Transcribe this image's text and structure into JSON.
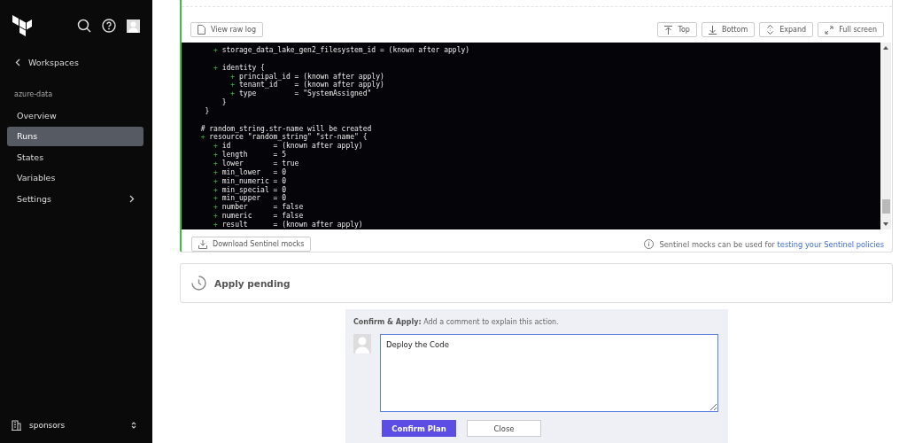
{
  "sidebar": {
    "back_link": "Workspaces",
    "workspace": "azure-data",
    "items": [
      {
        "label": "Overview",
        "selected": false,
        "expandable": false
      },
      {
        "label": "Runs",
        "selected": true,
        "expandable": false
      },
      {
        "label": "States",
        "selected": false,
        "expandable": false
      },
      {
        "label": "Variables",
        "selected": false,
        "expandable": false
      },
      {
        "label": "Settings",
        "selected": false,
        "expandable": true
      }
    ],
    "organization": "sponsors"
  },
  "log_panel": {
    "toolbar_left": [
      "View raw log"
    ],
    "toolbar_right": [
      "Top",
      "Bottom",
      "Expand",
      "Full screen"
    ],
    "lines": [
      {
        "kind": "add",
        "text": "     + storage_data_lake_gen2_filesystem_id = (known after apply)"
      },
      {
        "kind": "blank"
      },
      {
        "kind": "add",
        "text": "     + identity {"
      },
      {
        "kind": "add",
        "text": "         + principal_id = (known after apply)"
      },
      {
        "kind": "add",
        "text": "         + tenant_id    = (known after apply)"
      },
      {
        "kind": "add",
        "text": "         + type         = \"SystemAssigned\""
      },
      {
        "kind": "plain",
        "text": "       }"
      },
      {
        "kind": "plain",
        "text": "   }"
      },
      {
        "kind": "blank"
      },
      {
        "kind": "comment",
        "text": "  # random_string.str-name will be created"
      },
      {
        "kind": "add",
        "text": "  + resource \"random_string\" \"str-name\" {"
      },
      {
        "kind": "add",
        "text": "     + id          = (known after apply)"
      },
      {
        "kind": "add",
        "text": "     + length      = 5"
      },
      {
        "kind": "add",
        "text": "     + lower       = true"
      },
      {
        "kind": "add",
        "text": "     + min_lower   = 0"
      },
      {
        "kind": "add",
        "text": "     + min_numeric = 0"
      },
      {
        "kind": "add",
        "text": "     + min_special = 0"
      },
      {
        "kind": "add",
        "text": "     + min_upper   = 0"
      },
      {
        "kind": "add",
        "text": "     + number      = false"
      },
      {
        "kind": "add",
        "text": "     + numeric     = false"
      },
      {
        "kind": "add",
        "text": "     + result      = (known after apply)"
      }
    ],
    "download_button": "Download Sentinel mocks",
    "note": "Sentinel mocks can be used for",
    "note_link": "testing your Sentinel policies"
  },
  "apply_status": {
    "title": "Apply pending"
  },
  "confirm": {
    "label": "Confirm & Apply:",
    "hint": "Add a comment to explain this action.",
    "comment": "Deploy the Code",
    "primary_button": "Confirm Plan",
    "secondary_button": "Close"
  }
}
